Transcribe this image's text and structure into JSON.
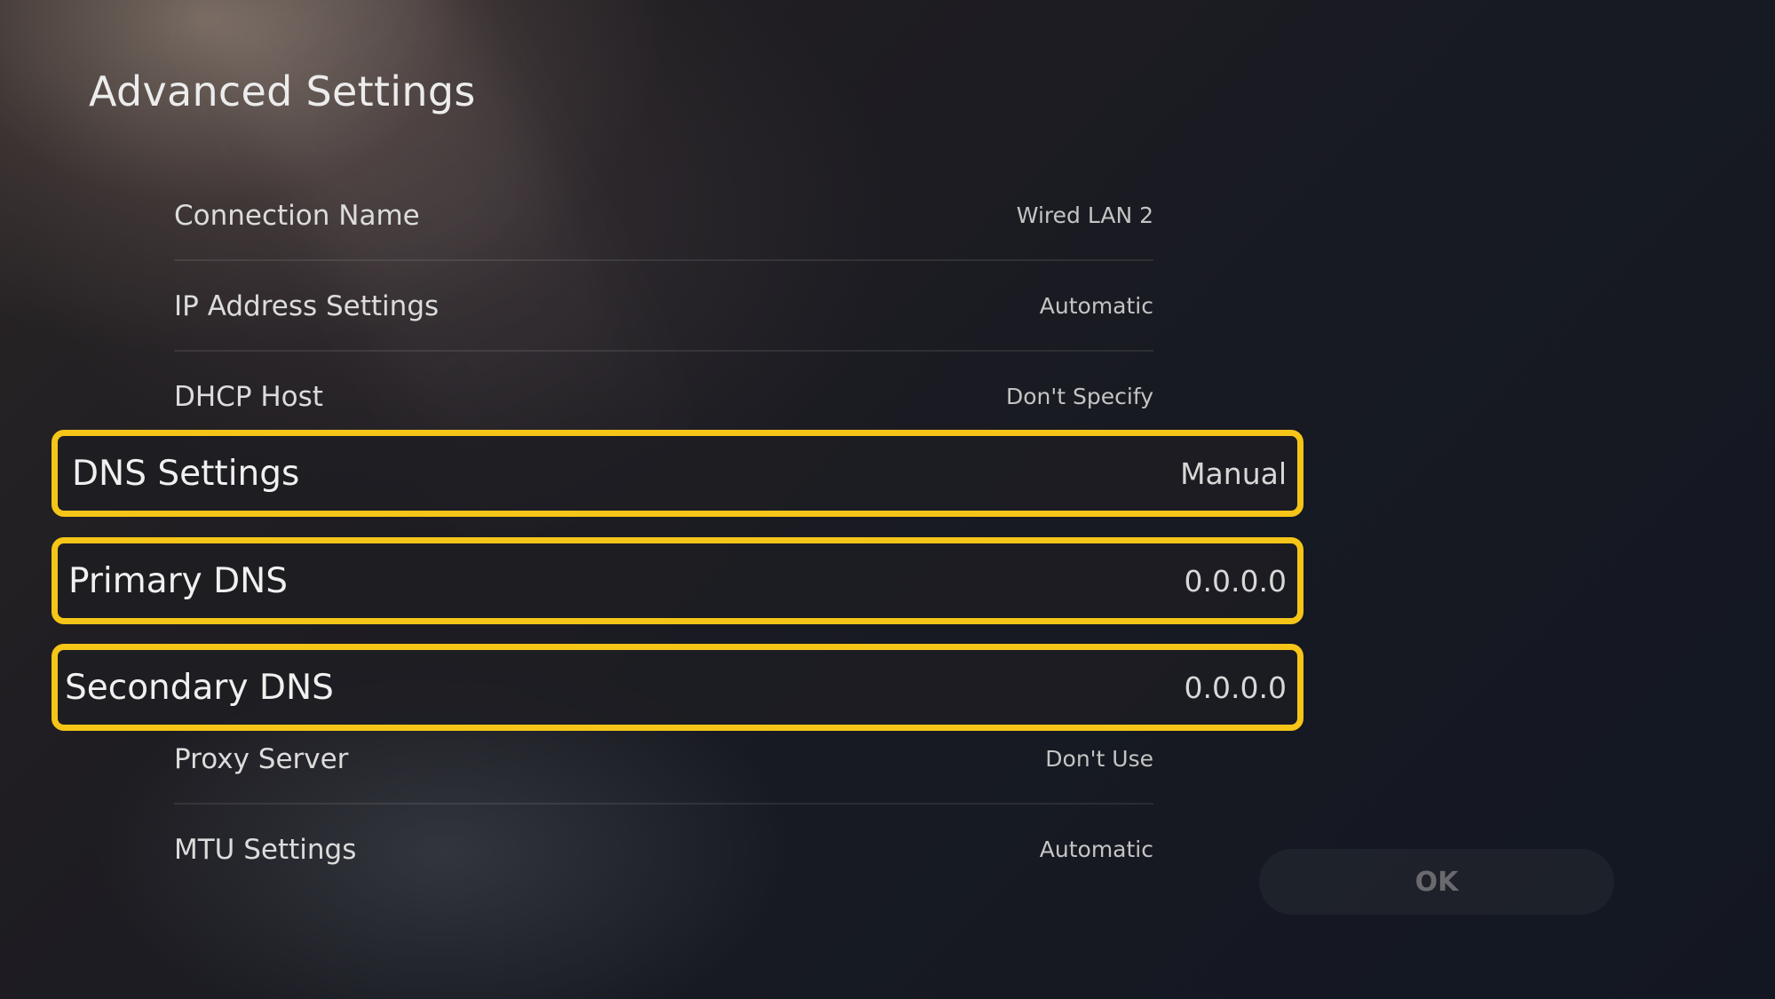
{
  "header": {
    "title": "Advanced Settings"
  },
  "settings": {
    "connection_name": {
      "label": "Connection Name",
      "value": "Wired LAN 2"
    },
    "ip_address_settings": {
      "label": "IP Address Settings",
      "value": "Automatic"
    },
    "dhcp_host": {
      "label": "DHCP Host",
      "value": "Don't Specify"
    },
    "dns_settings": {
      "label": "DNS Settings",
      "value": "Manual"
    },
    "primary_dns": {
      "label": "Primary DNS",
      "value": "0.0.0.0"
    },
    "secondary_dns": {
      "label": "Secondary DNS",
      "value": "0.0.0.0"
    },
    "proxy_server": {
      "label": "Proxy Server",
      "value": "Don't Use"
    },
    "mtu_settings": {
      "label": "MTU Settings",
      "value": "Automatic"
    }
  },
  "actions": {
    "ok_label": "OK"
  },
  "colors": {
    "highlight": "#f5c518",
    "background": "#151820"
  }
}
